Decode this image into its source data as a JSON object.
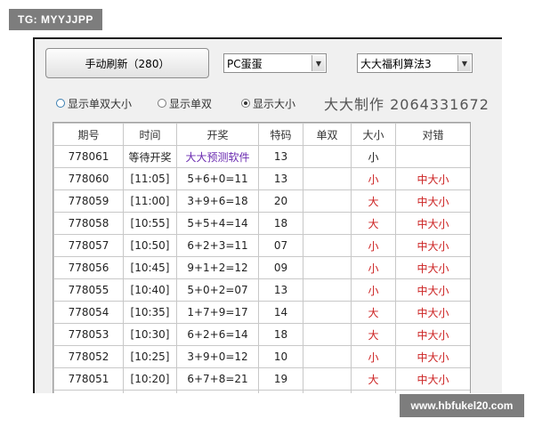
{
  "watermarks": {
    "top_left": "TG: MYYJJPP",
    "bottom_right": "www.hbfukel20.com"
  },
  "toolbar": {
    "refresh_label": "手动刷新（280）",
    "game_select": {
      "value": "PC蛋蛋"
    },
    "algorithm_select": {
      "value": "大大福利算法3"
    }
  },
  "radios": [
    {
      "label": "显示单双大小",
      "selected": false
    },
    {
      "label": "显示单双",
      "selected": false
    },
    {
      "label": "显示大小",
      "selected": true
    }
  ],
  "brand": "大大制作 2064331672",
  "table": {
    "headers": [
      "期号",
      "时间",
      "开奖",
      "特码",
      "单双",
      "大小",
      "对错"
    ],
    "rows": [
      [
        "778061",
        "等待开奖",
        "大大预测软件",
        "13",
        "",
        "小",
        ""
      ],
      [
        "778060",
        "[11:05]",
        "5+6+0=11",
        "13",
        "",
        "小",
        "中大小"
      ],
      [
        "778059",
        "[11:00]",
        "3+9+6=18",
        "20",
        "",
        "大",
        "中大小"
      ],
      [
        "778058",
        "[10:55]",
        "5+5+4=14",
        "18",
        "",
        "大",
        "中大小"
      ],
      [
        "778057",
        "[10:50]",
        "6+2+3=11",
        "07",
        "",
        "小",
        "中大小"
      ],
      [
        "778056",
        "[10:45]",
        "9+1+2=12",
        "09",
        "",
        "小",
        "中大小"
      ],
      [
        "778055",
        "[10:40]",
        "5+0+2=07",
        "13",
        "",
        "小",
        "中大小"
      ],
      [
        "778054",
        "[10:35]",
        "1+7+9=17",
        "14",
        "",
        "大",
        "中大小"
      ],
      [
        "778053",
        "[10:30]",
        "6+2+6=14",
        "18",
        "",
        "大",
        "中大小"
      ],
      [
        "778052",
        "[10:25]",
        "3+9+0=12",
        "10",
        "",
        "小",
        "中大小"
      ],
      [
        "778051",
        "[10:20]",
        "6+7+8=21",
        "19",
        "",
        "大",
        "中大小"
      ]
    ]
  }
}
